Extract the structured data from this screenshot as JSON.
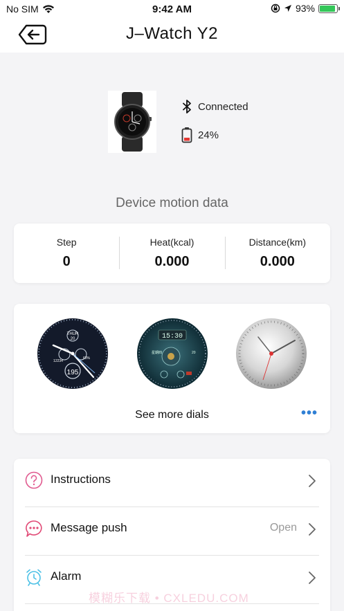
{
  "status_bar": {
    "carrier": "No SIM",
    "time": "9:42 AM",
    "battery_percent": "93%",
    "battery_level": 0.93
  },
  "header": {
    "title": "J–Watch Y2"
  },
  "device": {
    "connection_status": "Connected",
    "battery": "24%"
  },
  "motion_section_title": "Device motion data",
  "stats": [
    {
      "label": "Step",
      "value": "0"
    },
    {
      "label": "Heat(kcal)",
      "value": "0.000"
    },
    {
      "label": "Distance(km)",
      "value": "0.000"
    }
  ],
  "dials": {
    "dial_1": {
      "top_label": "THUR",
      "top_sub": "20",
      "left_value": "12234",
      "right_value": "60%",
      "bottom_value": "195"
    },
    "dial_2": {
      "time": "15:30",
      "date": "星期四",
      "side": "20"
    },
    "see_more_label": "See more dials",
    "more_icon": "•••"
  },
  "menu": [
    {
      "label": "Instructions",
      "icon": "question-icon",
      "value": ""
    },
    {
      "label": "Message push",
      "icon": "message-icon",
      "value": "Open"
    },
    {
      "label": "Alarm",
      "icon": "alarm-clock-icon",
      "value": ""
    }
  ],
  "watermark": "模糊乐下载 • CXLEDU.COM",
  "colors": {
    "accent_blue": "#2f7fd4",
    "instructions_icon": "#e05a8f",
    "message_icon": "#e14a76",
    "alarm_icon": "#4cc1e6",
    "battery_low": "#e53935",
    "battery_green": "#34c759"
  }
}
